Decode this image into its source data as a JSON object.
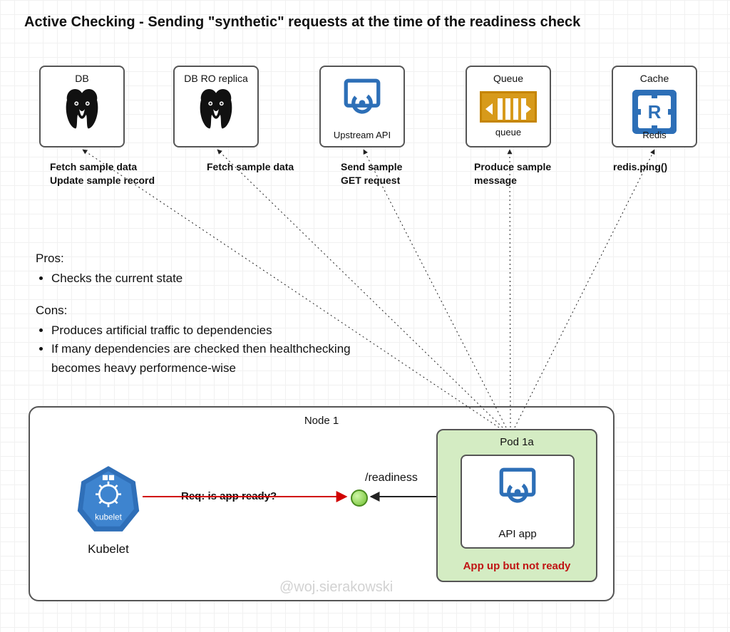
{
  "title": "Active Checking - Sending \"synthetic\" requests at the time of the readiness check",
  "dependencies": {
    "db": {
      "label": "DB",
      "icon": "postgresql-icon",
      "sublabel": ""
    },
    "db_ro": {
      "label": "DB RO replica",
      "icon": "postgresql-icon",
      "sublabel": ""
    },
    "upstream": {
      "label": "",
      "icon": "api-service-icon",
      "sublabel": "Upstream API"
    },
    "queue": {
      "label": "Queue",
      "icon": "queue-icon",
      "sublabel": "queue"
    },
    "cache": {
      "label": "Cache",
      "icon": "redis-icon",
      "sublabel": "Redis"
    }
  },
  "connections": {
    "db": {
      "label": "Fetch sample data\nUpdate sample record"
    },
    "db_ro": {
      "label": "Fetch sample data"
    },
    "upstream": {
      "label": "Send sample\nGET request"
    },
    "queue": {
      "label": "Produce sample\nmessage"
    },
    "cache": {
      "label": "redis.ping()"
    }
  },
  "pros_heading": "Pros:",
  "pros": [
    "Checks the current state"
  ],
  "cons_heading": "Cons:",
  "cons": [
    "Produces artificial traffic to dependencies",
    "If many dependencies are checked then healthchecking becomes heavy performence-wise"
  ],
  "node": {
    "title": "Node 1",
    "kubelet_label": "Kubelet",
    "kubelet_badge_text": "kubelet",
    "request_label": "Req: is app ready?",
    "readiness_path": "/readiness",
    "pod": {
      "title": "Pod 1a",
      "app_label": "API app",
      "status": "App up but not ready"
    }
  },
  "watermark": "@woj.sierakowski",
  "text": {
    "pg_alt": "PostgreSQL elephant",
    "svc_alt": "Service API",
    "queue_alt": "Queue",
    "redis_alt": "Redis",
    "kubelet_alt": "Kubelet hexagon badge"
  }
}
